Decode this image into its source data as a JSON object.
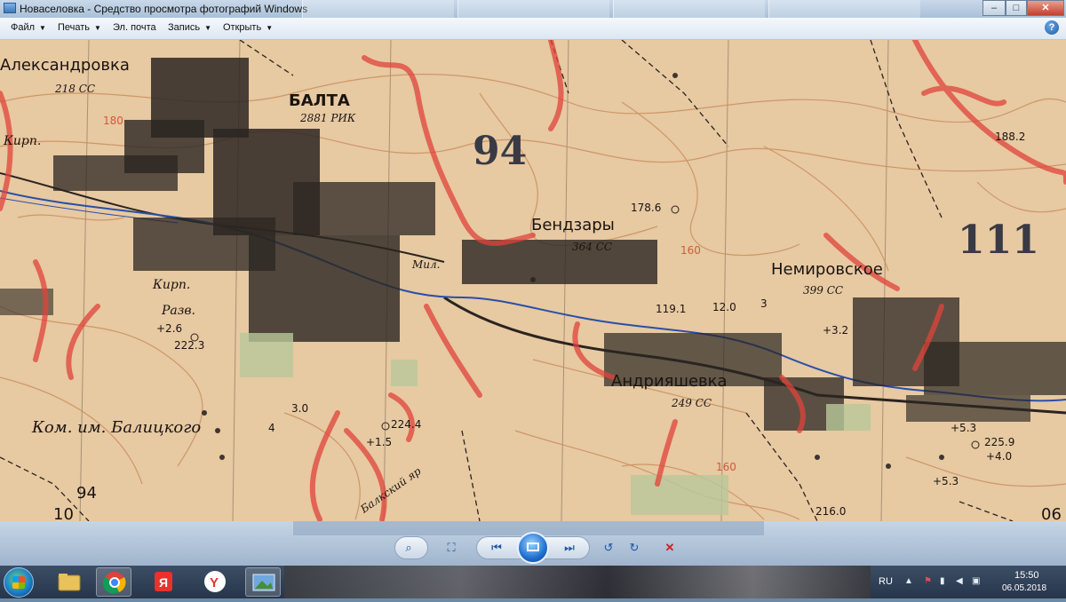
{
  "window": {
    "title": "Новаселовка - Средство просмотра фотографий Windows",
    "controls": {
      "minimize": "–",
      "maximize": "□",
      "close": "✕"
    }
  },
  "menu": {
    "items": [
      {
        "label": "Файл",
        "has_dropdown": true
      },
      {
        "label": "Печать",
        "has_dropdown": true
      },
      {
        "label": "Эл. почта",
        "has_dropdown": false
      },
      {
        "label": "Запись",
        "has_dropdown": true
      },
      {
        "label": "Открыть",
        "has_dropdown": true
      }
    ],
    "help": "?"
  },
  "map": {
    "labels": {
      "aleksandrovka": "Александровка",
      "alex_pop": "218 СС",
      "balta": "БАЛТА",
      "balta_pop": "2881 РИК",
      "kirp1": "Кирп.",
      "kirp2": "Кирп.",
      "razv": "Разв.",
      "mark_180": "180",
      "num_94_top": "94",
      "bendzary": "Бендзары",
      "bendzary_pop": "364 СС",
      "elev_1786": "178.6",
      "mark_160_top": "160",
      "nemirovskoe": "Немировское",
      "nemir_pop": "399 СС",
      "elev_1882": "188.2",
      "num_111": "111",
      "andriyashevka": "Андрияшевка",
      "andr_pop": "249 СС",
      "elev_1191": "119.1",
      "elev_120": "12.0",
      "elev_3": "3",
      "elev_32": "+3.2",
      "elev_26": "+2.6",
      "elev_2223": "222.3",
      "elev_30": "3.0",
      "kom_balitskogo": "Ком. им. Балицкого",
      "elev_2244": "224.4",
      "elev_15": "+1.5",
      "balka": "Балкский яр",
      "num_94_bottom": "94",
      "num_10": "10",
      "mark_160_bottom": "160",
      "elev_2160": "216.0",
      "elev_53a": "+5.3",
      "elev_2259": "225.9",
      "elev_40": "+4.0",
      "elev_53b": "+5.3",
      "num_06": "06",
      "num_4": "4",
      "mil": "Мил."
    }
  },
  "toolbar": {
    "zoom": "⌕",
    "fit": "⛶",
    "prev": "⏮",
    "next": "⏭",
    "rotate_left": "↺",
    "rotate_right": "↻",
    "delete": "✕"
  },
  "taskbar": {
    "language": "RU",
    "time": "15:50",
    "date": "06.05.2018"
  },
  "colors": {
    "map_paper": "#e7c9a2",
    "contour": "#c98a5a",
    "red_pencil": "#e0433a",
    "river": "#2a4fa8",
    "town_block": "#2b2622"
  }
}
